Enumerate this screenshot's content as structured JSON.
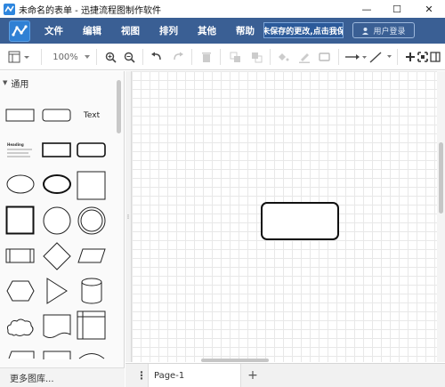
{
  "window": {
    "title": "未命名的表单 - 迅捷流程图制作软件",
    "minimize": "—",
    "maximize": "☐",
    "close": "✕"
  },
  "menu": {
    "items": [
      "文件",
      "编辑",
      "视图",
      "排列",
      "其他",
      "帮助"
    ],
    "unsaved_notice": "有未保存的更改,点击我保存",
    "login": "用户登录"
  },
  "toolbar": {
    "zoom": "100%"
  },
  "sidebar": {
    "section_title": "通用",
    "text_shape_label": "Text",
    "heading_shape_label": "Heading",
    "more_shapes": "更多图库..."
  },
  "pages": {
    "current": "Page-1",
    "add": "+"
  },
  "colors": {
    "menubar": "#3a5f94",
    "accent": "#2f80d4"
  }
}
